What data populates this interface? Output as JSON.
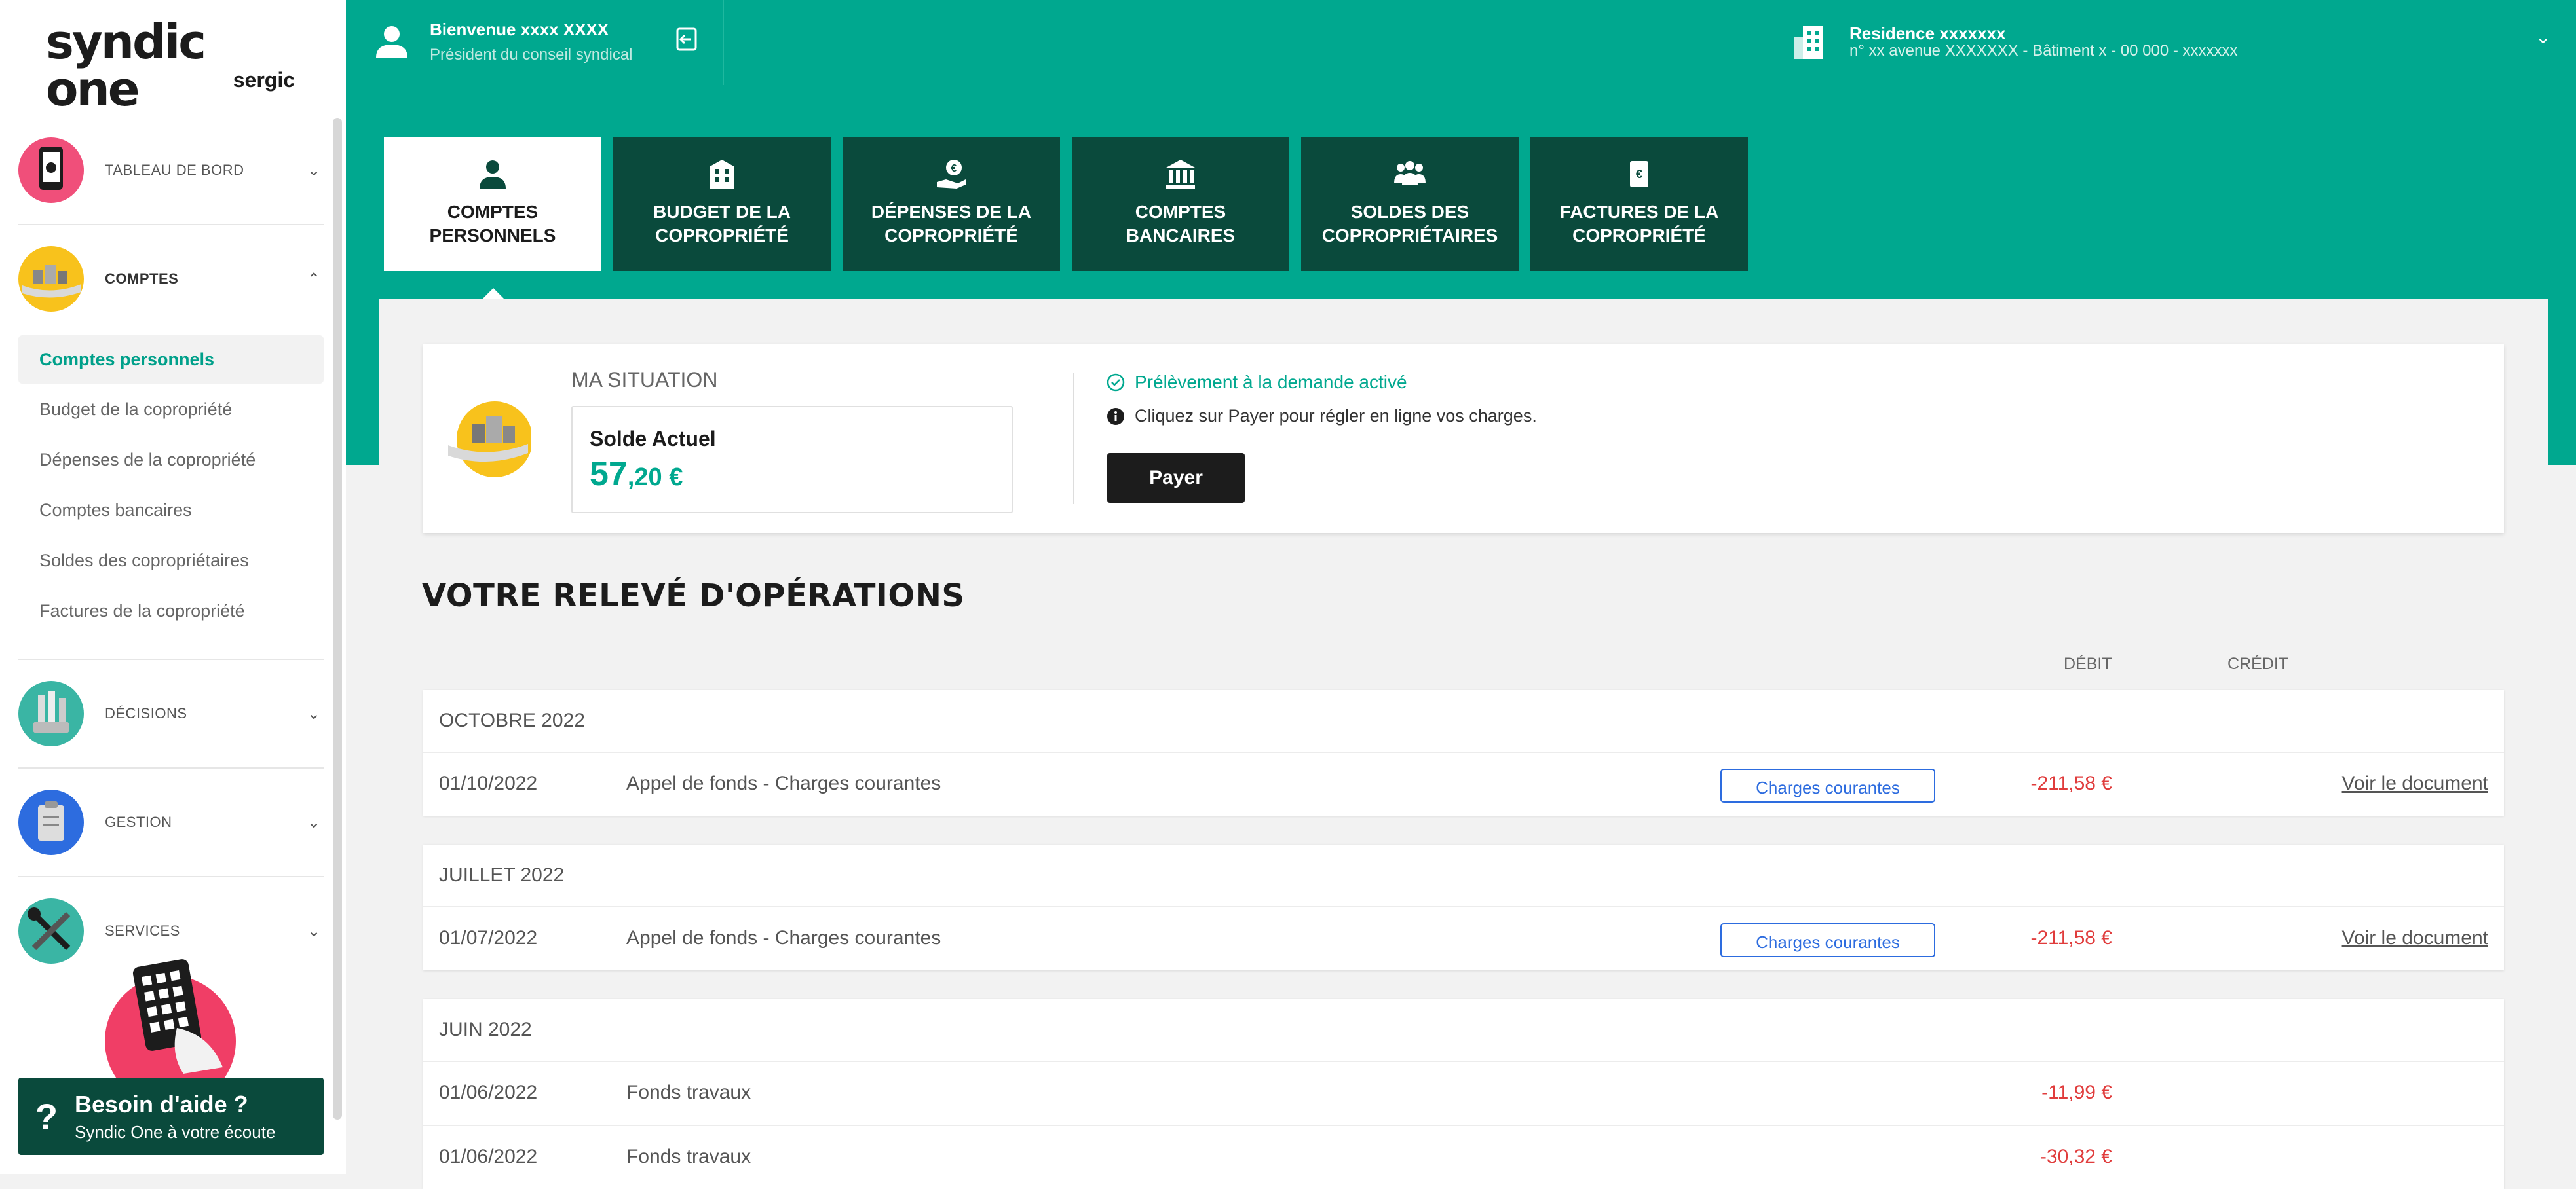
{
  "logo": {
    "main": "syndic one",
    "sub": "sergic"
  },
  "sidebar": {
    "sections": [
      {
        "label": "TABLEAU DE BORD",
        "chevron": "⌄"
      },
      {
        "label": "COMPTES",
        "chevron": "⌃"
      },
      {
        "label": "DÉCISIONS",
        "chevron": "⌄"
      },
      {
        "label": "GESTION",
        "chevron": "⌄"
      },
      {
        "label": "SERVICES",
        "chevron": "⌄"
      }
    ],
    "sub_items": [
      "Comptes personnels",
      "Budget de la copropriété",
      "Dépenses de la copropriété",
      "Comptes bancaires",
      "Soldes des copropriétaires",
      "Factures de la copropriété"
    ],
    "help": {
      "icon": "?",
      "title": "Besoin d'aide ?",
      "subtitle": "Syndic One à votre écoute"
    }
  },
  "header": {
    "welcome": "Bienvenue xxxx XXXX",
    "role": "Président du conseil syndical",
    "residence_name": "Residence xxxxxxx",
    "residence_address": "n° xx avenue XXXXXXX - Bâtiment x - 00 000 - xxxxxxx",
    "chevron": "⌄"
  },
  "tabs": [
    {
      "line1": "COMPTES",
      "line2": "PERSONNELS",
      "icon": "person-icon"
    },
    {
      "line1": "BUDGET DE LA",
      "line2": "COPROPRIÉTÉ",
      "icon": "building-icon"
    },
    {
      "line1": "DÉPENSES DE LA",
      "line2": "COPROPRIÉTÉ",
      "icon": "hand-euro-icon"
    },
    {
      "line1": "COMPTES",
      "line2": "BANCAIRES",
      "icon": "bank-icon"
    },
    {
      "line1": "SOLDES DES",
      "line2": "COPROPRIÉTAIRES",
      "icon": "group-icon"
    },
    {
      "line1": "FACTURES DE LA",
      "line2": "COPROPRIÉTÉ",
      "icon": "invoice-icon"
    }
  ],
  "situation": {
    "title": "MA SITUATION",
    "solde_label": "Solde Actuel",
    "solde_int": "57",
    "solde_dec": ",20 €",
    "prelevement": "Prélèvement à la demande activé",
    "info": "Cliquez sur Payer pour régler en ligne vos charges.",
    "pay_label": "Payer"
  },
  "releve": {
    "title": "VOTRE RELEVÉ D'OPÉRATIONS",
    "col_debit": "DÉBIT",
    "col_credit": "CRÉDIT",
    "groups": [
      {
        "month": "OCTOBRE 2022",
        "rows": [
          {
            "date": "01/10/2022",
            "label": "Appel de fonds - Charges courantes",
            "badge": "Charges courantes",
            "debit": "-211,58 €",
            "doc": "Voir le document"
          }
        ]
      },
      {
        "month": "JUILLET 2022",
        "rows": [
          {
            "date": "01/07/2022",
            "label": "Appel de fonds - Charges courantes",
            "badge": "Charges courantes",
            "debit": "-211,58 €",
            "doc": "Voir le document"
          }
        ]
      },
      {
        "month": "JUIN 2022",
        "rows": [
          {
            "date": "01/06/2022",
            "label": "Fonds travaux",
            "debit": "-11,99 €"
          },
          {
            "date": "01/06/2022",
            "label": "Fonds travaux",
            "debit": "-30,32 €"
          }
        ]
      }
    ]
  },
  "colors": {
    "accent": "#00a88f",
    "dark_green": "#0a4a3c",
    "debit_red": "#e03c3c",
    "badge_blue": "#2d6cdf"
  }
}
